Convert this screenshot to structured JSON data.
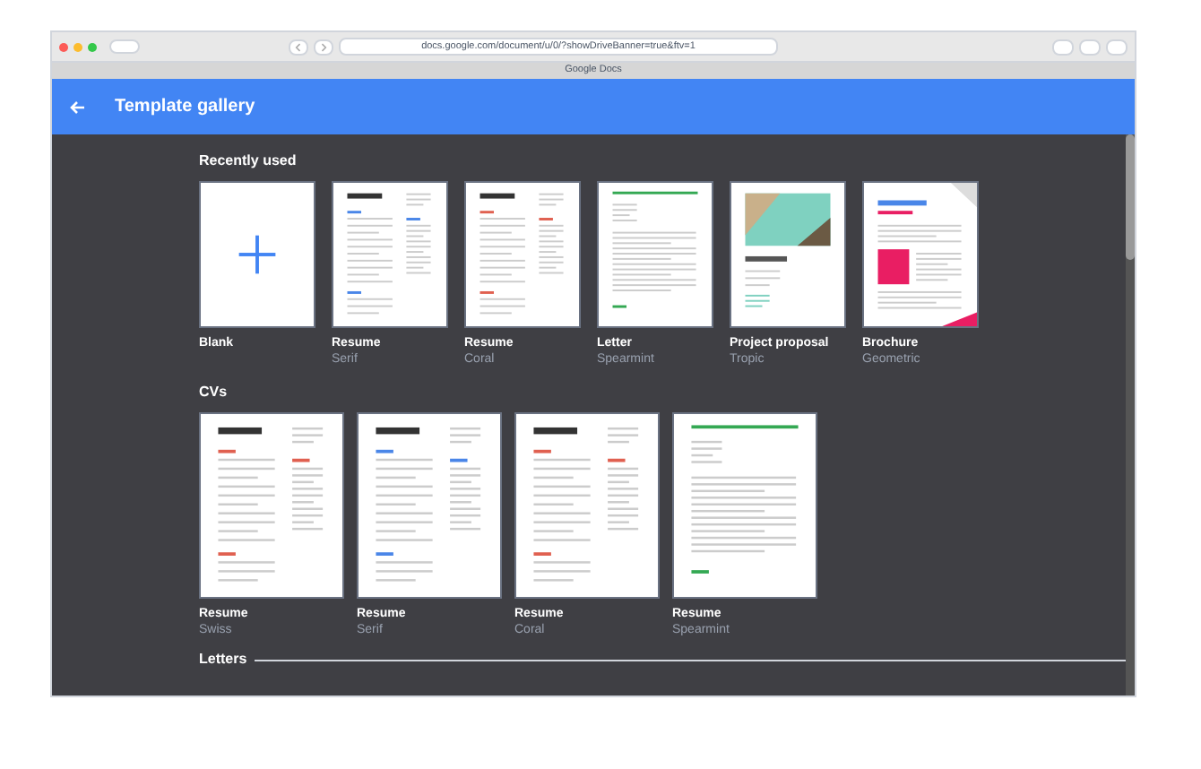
{
  "browser": {
    "url": "docs.google.com/document/u/0/?showDriveBanner=true&ftv=1",
    "tab_title": "Google Docs"
  },
  "header": {
    "title": "Template gallery"
  },
  "sections": [
    {
      "title": "Recently used",
      "kind": "small",
      "templates": [
        {
          "kind": "blank",
          "name": "Blank"
        },
        {
          "kind": "resume-serif",
          "name": "Resume",
          "style": "Serif"
        },
        {
          "kind": "resume-coral",
          "name": "Resume",
          "style": "Coral"
        },
        {
          "kind": "letter",
          "name": "Letter",
          "style": "Spearmint"
        },
        {
          "kind": "proposal",
          "name": "Project proposal",
          "style": "Tropic"
        },
        {
          "kind": "brochure",
          "name": "Brochure",
          "style": "Geometric"
        }
      ]
    },
    {
      "title": "CVs",
      "kind": "large",
      "templates": [
        {
          "kind": "resume-swiss",
          "name": "Resume",
          "style": "Swiss"
        },
        {
          "kind": "resume-serif",
          "name": "Resume",
          "style": "Serif"
        },
        {
          "kind": "resume-coral",
          "name": "Resume",
          "style": "Coral"
        },
        {
          "kind": "resume-spearmint",
          "name": "Resume",
          "style": "Spearmint"
        }
      ]
    },
    {
      "title": "Letters",
      "kind": "divider"
    }
  ]
}
